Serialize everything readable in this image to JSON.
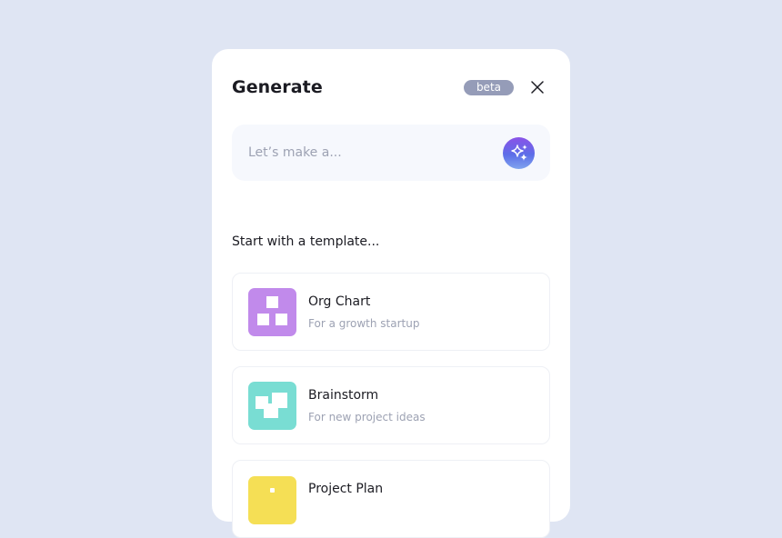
{
  "header": {
    "title": "Generate",
    "badge": "beta"
  },
  "prompt": {
    "placeholder": "Let’s make a..."
  },
  "templates": {
    "section_label": "Start with a template...",
    "items": [
      {
        "title": "Org Chart",
        "subtitle": "For a growth startup",
        "color": "#c18aeb"
      },
      {
        "title": "Brainstorm",
        "subtitle": "For new project ideas",
        "color": "#79ddd3"
      },
      {
        "title": "Project Plan",
        "subtitle": "",
        "color": "#f5df55"
      }
    ]
  },
  "colors": {
    "background": "#dfe5f3",
    "panel": "#ffffff",
    "badge": "#959cb8",
    "prompt_bg": "#f6f8fd"
  },
  "icons": {
    "close": "close-icon",
    "sparkle": "sparkle-icon"
  }
}
